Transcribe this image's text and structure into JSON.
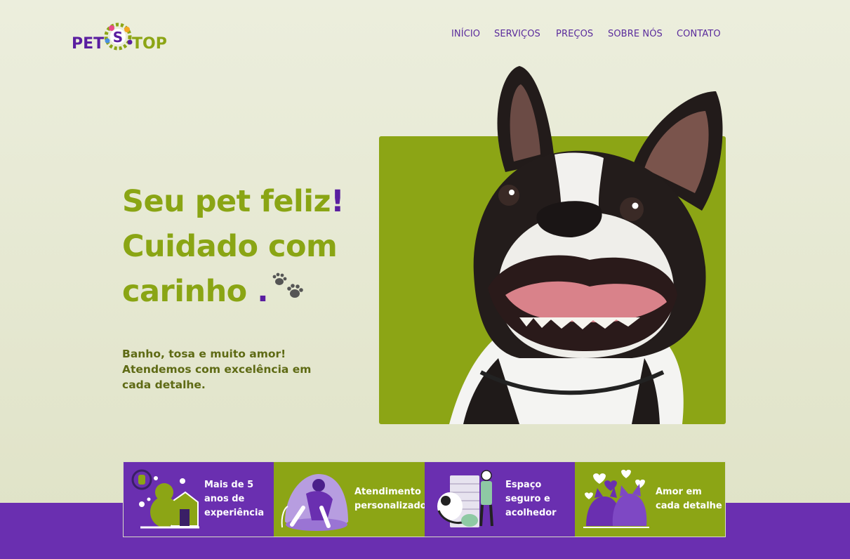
{
  "brand": {
    "logo_left": "PET",
    "logo_mid": "S",
    "logo_right": "TOP"
  },
  "nav": [
    {
      "label": "INÍCIO"
    },
    {
      "label": "SERVIÇOS"
    },
    {
      "label": "PREÇOS"
    },
    {
      "label": "SOBRE NÓS"
    },
    {
      "label": "CONTATO"
    }
  ],
  "hero": {
    "line1": "Seu pet feliz",
    "line1_mark": "!",
    "line2": "Cuidado com",
    "line3": "carinho",
    "line3_mark": ".",
    "subtext": "Banho, tosa e muito amor! Atendemos com excelência em cada detalhe."
  },
  "features": [
    {
      "text": "Mais de 5 anos de experiência",
      "icon": "dog-house-icon"
    },
    {
      "text": "Atendimento personalizado",
      "icon": "hug-pet-icon"
    },
    {
      "text": "Espaço seguro e acolhedor",
      "icon": "pet-care-icon"
    },
    {
      "text": "Amor em cada detalhe",
      "icon": "pets-love-icon"
    }
  ],
  "colors": {
    "green": "#8ca515",
    "purple": "#6a2fb0",
    "background": "#e6e8d3"
  }
}
